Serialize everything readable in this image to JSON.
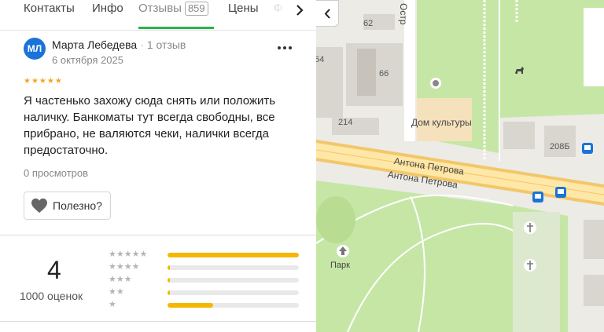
{
  "tabs": {
    "items": [
      {
        "label": "Контакты"
      },
      {
        "label": "Инфо"
      },
      {
        "label": "Отзывы",
        "count": "859"
      },
      {
        "label": "Цены"
      },
      {
        "label": "Ф"
      }
    ],
    "active_index": 2
  },
  "review": {
    "avatar_initials": "МЛ",
    "author": "Марта Лебедева",
    "author_separator": "·",
    "author_reviews": "1 отзыв",
    "date": "6 октября 2025",
    "stars": "★★★★★",
    "rating": 5,
    "text": "Я частенько захожу сюда снять или положить наличку. Банкоматы тут всегда свободны, все прибрано, не валяются чеки, налички всегда предостаточно.",
    "views": "0 просмотров",
    "helpful_label": "Полезно?"
  },
  "summary": {
    "rating": "4",
    "count": "1000 оценок",
    "rows": [
      {
        "stars": "★★★★★",
        "fraction": 1.0
      },
      {
        "stars": "★★★★",
        "fraction": 0.02
      },
      {
        "stars": "★★★",
        "fraction": 0.02
      },
      {
        "stars": "★★",
        "fraction": 0.02
      },
      {
        "stars": "★",
        "fraction": 0.35
      }
    ]
  },
  "map": {
    "labels": {
      "street_top": "Остр",
      "house_62": "62",
      "house_64": "64",
      "house_66": "66",
      "house_214": "214",
      "dom_kultury": "Дом культуры",
      "house_208b": "208Б",
      "road_1": "Антона Петрова",
      "road_2": "Антона Петрова",
      "park": "Парк"
    },
    "colors": {
      "background": "#ecebe6",
      "park_green": "#c6e6a6",
      "road": "#ffe7a8",
      "road_edge": "#f2c76a",
      "building": "#d9d6cf",
      "accent_blue": "#1a73d9"
    }
  }
}
